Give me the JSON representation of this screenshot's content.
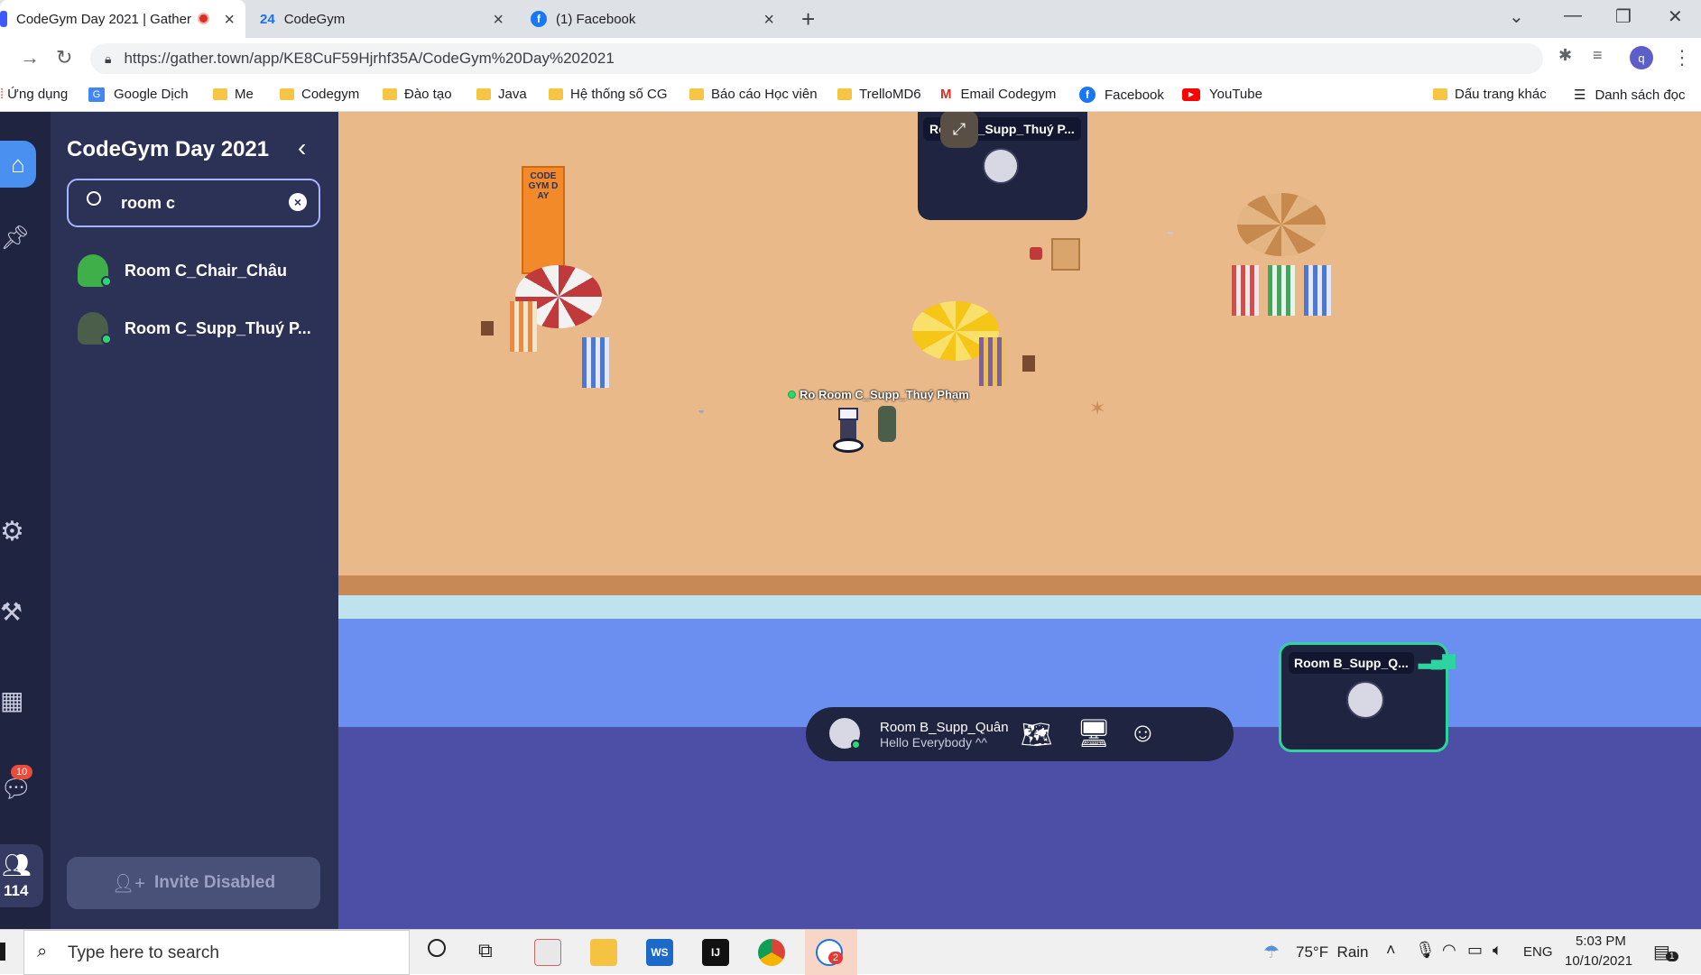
{
  "tabs": [
    {
      "title": "CodeGym Day 2021 | Gather"
    },
    {
      "title": "CodeGym"
    },
    {
      "title": "(1) Facebook"
    }
  ],
  "address": {
    "url": "https://gather.town/app/KE8CuF59Hjrhf35A/CodeGym%20Day%202021"
  },
  "bookmarks": [
    {
      "label": "Ứng dụng"
    },
    {
      "label": "Google Dịch"
    },
    {
      "label": "Me"
    },
    {
      "label": "Codegym"
    },
    {
      "label": "Đào tạo"
    },
    {
      "label": "Java"
    },
    {
      "label": "Hệ thống số CG"
    },
    {
      "label": "Báo cáo Học viên"
    },
    {
      "label": "TrelloMD6"
    },
    {
      "label": "Email Codegym"
    },
    {
      "label": "Facebook"
    },
    {
      "label": "YouTube"
    },
    {
      "label": "Dấu trang khác"
    },
    {
      "label": "Danh sách đọc"
    }
  ],
  "sidebar": {
    "title": "CodeGym Day 2021",
    "search_value": "room c",
    "results": [
      {
        "name": "Room C_Chair_Châu"
      },
      {
        "name": "Room C_Supp_Thuý P..."
      }
    ],
    "invite_label": "Invite Disabled",
    "chat_badge": "10",
    "people_count": "114"
  },
  "map": {
    "video_tile_top": "Room C_Supp_Thuý P...",
    "player_label": "Ro Room C_Supp_Thuý Phạm",
    "banner_text": "CODEGYM DAY",
    "video_tile_self": "Room B_Supp_Q..."
  },
  "bottom_bar": {
    "user_name": "Room B_Supp_Quân",
    "status": "Hello Everybody ^^"
  },
  "taskbar": {
    "search_placeholder": "Type here to search",
    "weather": "75°F  Rain",
    "lang": "ENG",
    "time": "5:03 PM",
    "date": "10/10/2021",
    "zalo_badge": "2",
    "notif_badge": "1"
  },
  "colors": {
    "panel_bg": "#2c3255",
    "rail_bg": "#1f2440",
    "accent": "#4a90f0",
    "online": "#2ed573",
    "tile_border": "#2dd4a0"
  }
}
